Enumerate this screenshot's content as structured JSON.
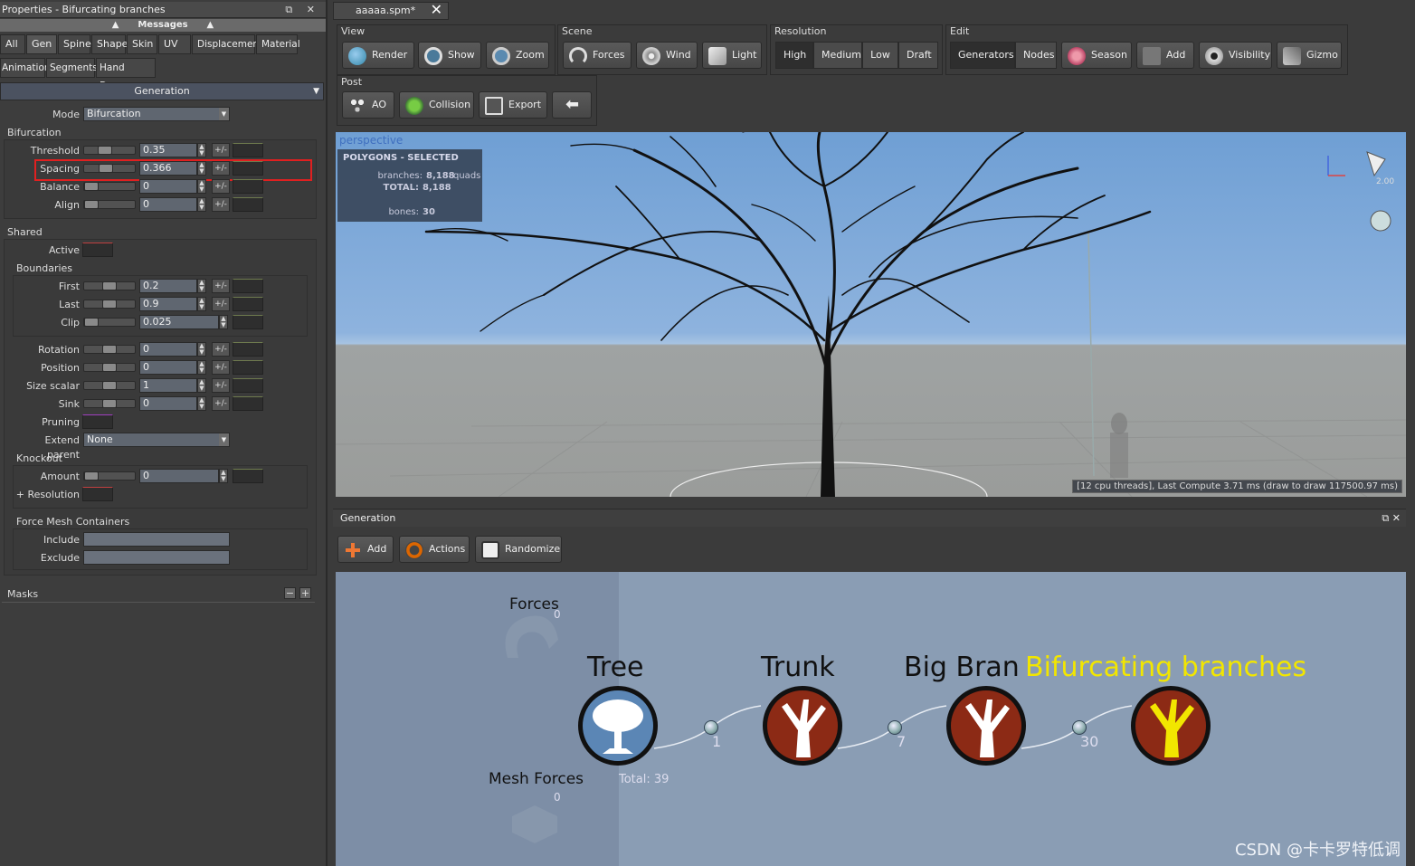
{
  "left_panel": {
    "title": "Properties - Bifurcating branches",
    "title_controls": "⧉ ✕",
    "messages_label": "Messages",
    "tabs_row1": [
      "All",
      "Gen",
      "Spine",
      "Shape",
      "Skin",
      "UV",
      "Displacement",
      "Material"
    ],
    "tabs_row2": [
      "Animation",
      "Segments",
      "Hand Drawn"
    ],
    "generation_label": "Generation",
    "mode": {
      "label": "Mode",
      "value": "Bifurcation"
    },
    "bifurcation": {
      "label": "Bifurcation",
      "rows": [
        {
          "label": "Threshold",
          "value": "0.35",
          "pm": "+/-",
          "level": 0.35
        },
        {
          "label": "Spacing",
          "value": "0.366",
          "pm": "+/-",
          "level": 0.37
        },
        {
          "label": "Balance",
          "value": "0",
          "pm": "+/-",
          "level": 0
        },
        {
          "label": "Align",
          "value": "0",
          "pm": "+/-",
          "level": 0
        }
      ]
    },
    "shared": {
      "label": "Shared",
      "active_label": "Active",
      "boundaries_label": "Boundaries",
      "boundaries": [
        {
          "label": "First",
          "value": "0.2",
          "pm": "+/-"
        },
        {
          "label": "Last",
          "value": "0.9",
          "pm": "+/-"
        },
        {
          "label": "Clip",
          "value": "0.025"
        }
      ],
      "rows": [
        {
          "label": "Rotation",
          "value": "0",
          "pm": "+/-"
        },
        {
          "label": "Position",
          "value": "0",
          "pm": "+/-"
        },
        {
          "label": "Size scalar",
          "value": "1",
          "pm": "+/-"
        },
        {
          "label": "Sink",
          "value": "0",
          "pm": "+/-"
        }
      ],
      "pruning_label": "Pruning",
      "extend_parent": {
        "label": "Extend parent",
        "value": "None"
      },
      "knockout": {
        "label": "Knockout",
        "amount_label": "Amount",
        "amount_value": "0",
        "resolution_label": "+ Resolution"
      },
      "force_mesh": {
        "label": "Force Mesh Containers",
        "include_label": "Include",
        "exclude_label": "Exclude"
      }
    },
    "masks_label": "Masks",
    "masks_controls": [
      "−",
      "+"
    ]
  },
  "doc_tab": {
    "label": "aaaaa.spm*",
    "close": "✕"
  },
  "toolbar": {
    "view": {
      "title": "View",
      "buttons": [
        "Render",
        "Show",
        "Zoom"
      ]
    },
    "scene": {
      "title": "Scene",
      "buttons": [
        "Forces",
        "Wind",
        "Light"
      ]
    },
    "resolution": {
      "title": "Resolution",
      "options": [
        "High",
        "Medium",
        "Low",
        "Draft"
      ],
      "selected": "High"
    },
    "edit": {
      "title": "Edit",
      "segments": [
        "Generators",
        "Nodes"
      ],
      "buttons": [
        "Season",
        "Add",
        "Visibility",
        "Gizmo"
      ]
    },
    "post": {
      "title": "Post",
      "buttons": [
        "AO",
        "Collision",
        "Export"
      ]
    }
  },
  "viewport": {
    "label": "perspective",
    "poly_title": "POLYGONS - SELECTED",
    "branches_label": "branches:",
    "branches_value": "8,188",
    "branches_unit": "quads",
    "total_label": "TOTAL:",
    "total_value": "8,188",
    "bones_label": "bones:",
    "bones_value": "30",
    "gizmo_label": "2.00",
    "stats": "[12 cpu threads], Last Compute 3.71 ms (draw to draw 117500.97 ms)"
  },
  "generation_panel": {
    "title": "Generation",
    "controls": "⧉ ✕",
    "buttons": [
      "Add",
      "Actions",
      "Randomize"
    ],
    "forces_label": "Forces",
    "forces_count": "0",
    "mesh_forces_label": "Mesh Forces",
    "mesh_forces_count": "0",
    "total_label": "Total: 39",
    "nodes": [
      {
        "label": "Tree",
        "count": "1"
      },
      {
        "label": "Trunk",
        "count": "7"
      },
      {
        "label": "Big Bran",
        "count": "30"
      },
      {
        "label": "Bifurcating branches",
        "count": ""
      }
    ],
    "colors": {
      "tree": "#5b86b5",
      "trunk": "#8c2a15",
      "selected": "#f2e600"
    }
  },
  "watermark": "CSDN @卡卡罗特低调"
}
